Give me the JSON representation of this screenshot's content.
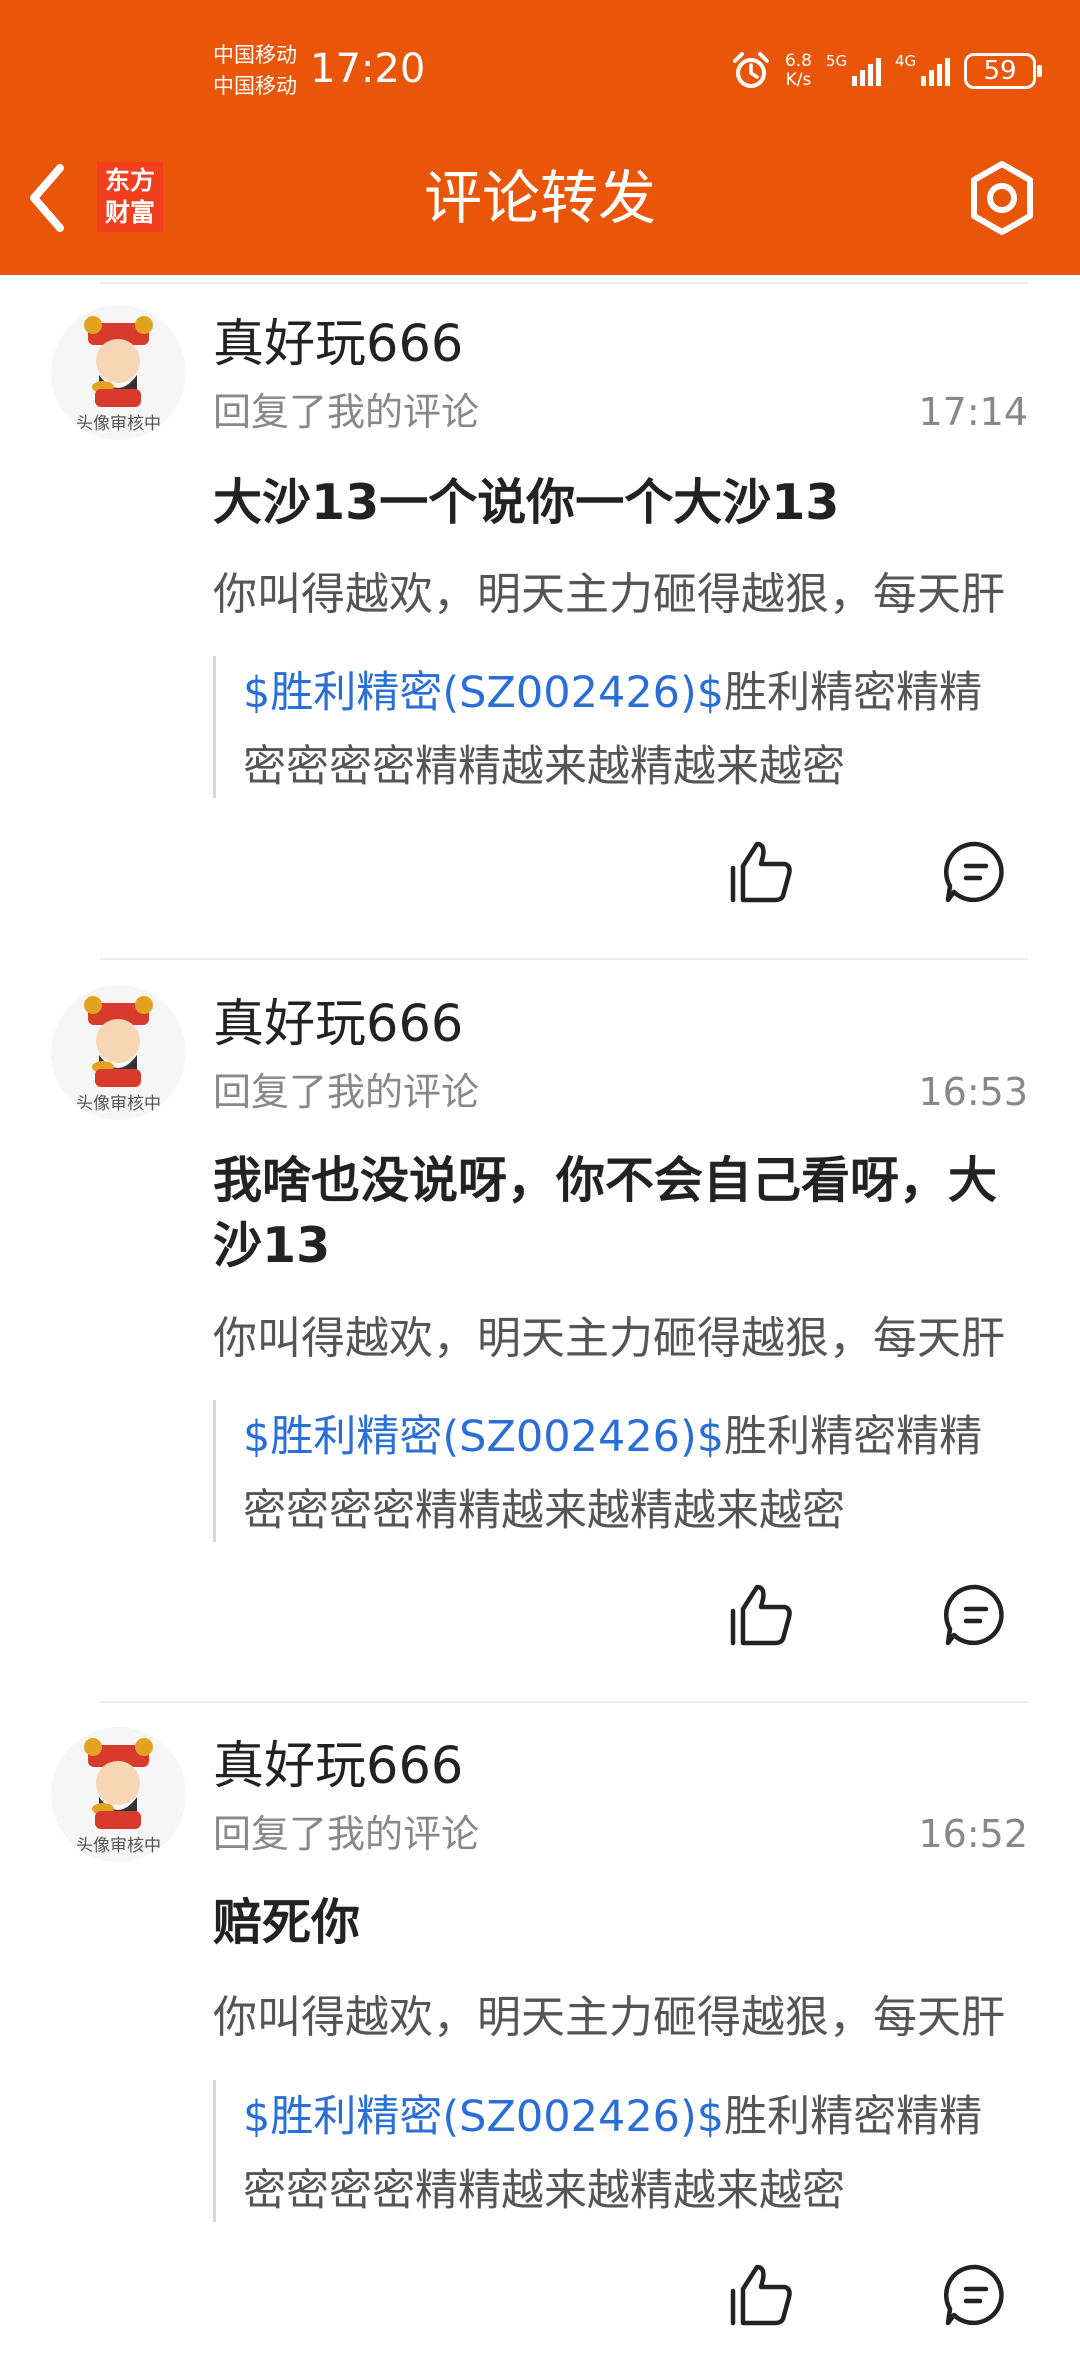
{
  "status_bar": {
    "carrier1": "中国移动",
    "carrier2": "中国移动",
    "time": "17:20",
    "net_speed_value": "6.8",
    "net_speed_unit": "K/s",
    "signal1_label": "5G",
    "signal2_label": "4G",
    "battery": "59"
  },
  "header": {
    "title": "评论转发",
    "logo_line1": "东方",
    "logo_line2": "财富",
    "accent_color": "#e9560a"
  },
  "comments": [
    {
      "username": "真好玩666",
      "action": "回复了我的评论",
      "time": "17:14",
      "reply": "大沙13一个说你一个大沙13",
      "original": "你叫得越欢，明天主力砸得越狠，每天肝",
      "quote_tag": "$胜利精密(SZ002426)$",
      "quote_text1": "胜利精密精精",
      "quote_text2": "密密密密精精越来越精越来越密",
      "avatar_watermark": "头像审核中"
    },
    {
      "username": "真好玩666",
      "action": "回复了我的评论",
      "time": "16:53",
      "reply": "我啥也没说呀，你不会自己看呀，大沙13",
      "original": "你叫得越欢，明天主力砸得越狠，每天肝",
      "quote_tag": "$胜利精密(SZ002426)$",
      "quote_text1": "胜利精密精精",
      "quote_text2": "密密密密精精越来越精越来越密",
      "avatar_watermark": "头像审核中"
    },
    {
      "username": "真好玩666",
      "action": "回复了我的评论",
      "time": "16:52",
      "reply": "赔死你",
      "original": "你叫得越欢，明天主力砸得越狠，每天肝",
      "quote_tag": "$胜利精密(SZ002426)$",
      "quote_text1": "胜利精密精精",
      "quote_text2": "密密密密精精越来越精越来越密",
      "avatar_watermark": "头像审核中"
    }
  ]
}
